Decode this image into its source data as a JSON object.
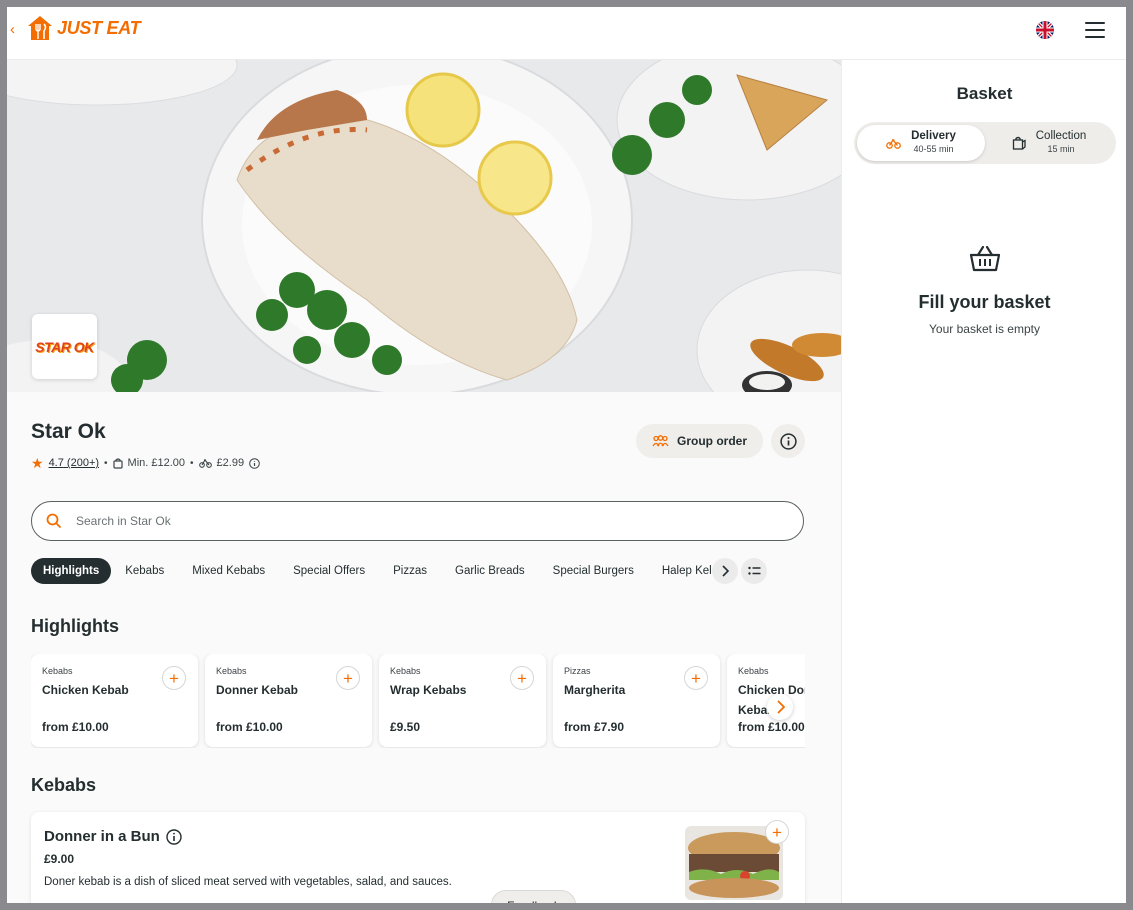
{
  "header": {
    "back_label": "‹",
    "brand": "JUST EAT",
    "language_icon": "uk-flag-icon",
    "menu_icon": "menu-icon"
  },
  "store": {
    "logo_text": "STAR OK",
    "name": "Star Ok",
    "rating": "4.7",
    "reviews": "(200+)",
    "min_order": "Min. £12.00",
    "delivery_fee": "£2.99",
    "group_order_label": "Group order"
  },
  "search": {
    "placeholder": "Search in Star Ok"
  },
  "categories": [
    "Highlights",
    "Kebabs",
    "Mixed Kebabs",
    "Special Offers",
    "Pizzas",
    "Garlic Breads",
    "Special Burgers",
    "Halep Kebabs"
  ],
  "highlights": {
    "title": "Highlights",
    "items": [
      {
        "category": "Kebabs",
        "name": "Chicken Kebab",
        "price": "from £10.00"
      },
      {
        "category": "Kebabs",
        "name": "Donner Kebab",
        "price": "from £10.00"
      },
      {
        "category": "Kebabs",
        "name": "Wrap Kebabs",
        "price": "£9.50"
      },
      {
        "category": "Pizzas",
        "name": "Margherita",
        "price": "from £7.90"
      },
      {
        "category": "Kebabs",
        "name": "Chicken Donner Kebab",
        "price": "from £10.00"
      }
    ]
  },
  "kebabs": {
    "title": "Kebabs",
    "item": {
      "name": "Donner in a Bun",
      "price": "£9.00",
      "description": "Doner kebab is a dish of sliced meat served with vegetables, salad, and sauces."
    }
  },
  "feedback_label": "Feedback",
  "basket": {
    "title": "Basket",
    "delivery_label": "Delivery",
    "delivery_time": "40-55 min",
    "collection_label": "Collection",
    "collection_time": "15 min",
    "empty_title": "Fill your basket",
    "empty_sub": "Your basket is empty"
  },
  "colors": {
    "brand": "#f36d00",
    "text": "#242e30",
    "pill_bg": "#f0eeeb"
  }
}
